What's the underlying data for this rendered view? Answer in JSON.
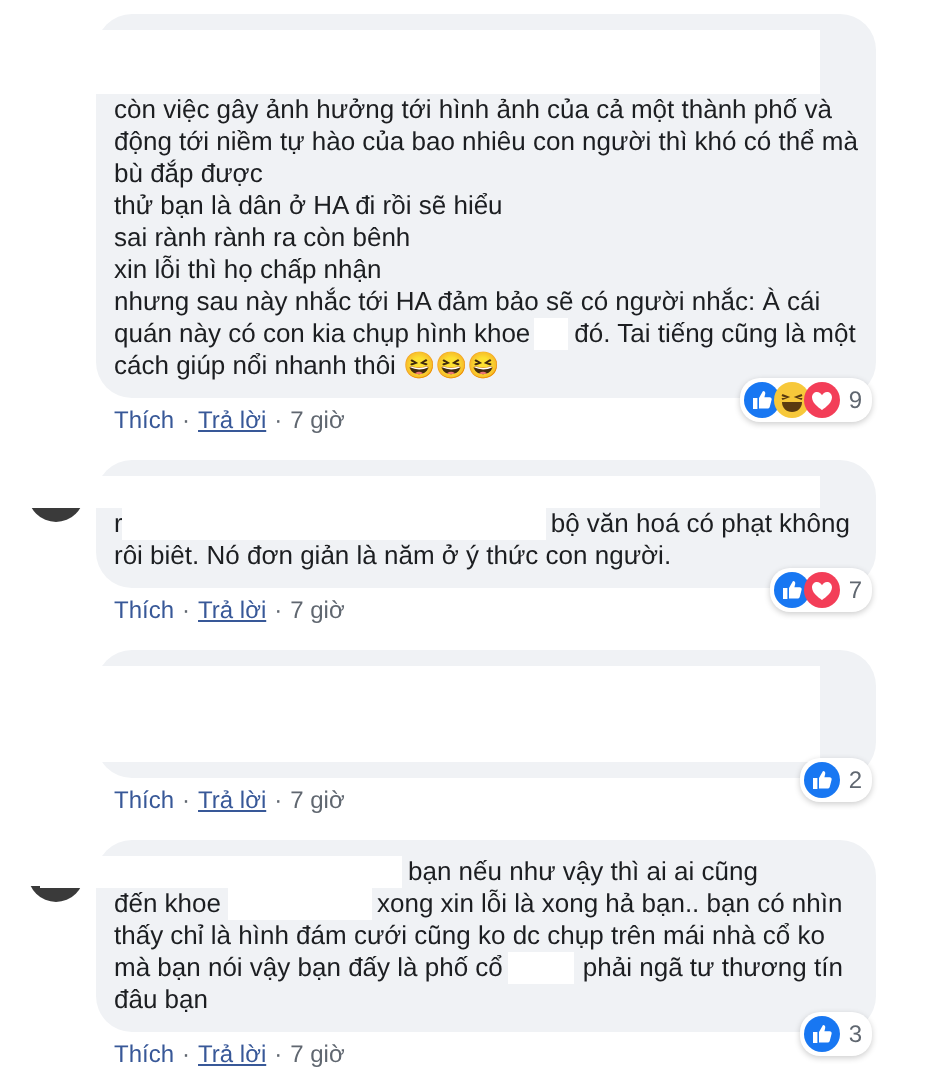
{
  "comments": [
    {
      "avatar": false,
      "lines": [
        {
          "parts": [
            {
              "kind": "full"
            }
          ]
        },
        {
          "parts": [
            {
              "kind": "full"
            }
          ]
        },
        {
          "parts": [
            {
              "kind": "text",
              "text": "còn việc gây ảnh hưởng tới hình ảnh của cả một thành phố và"
            }
          ]
        },
        {
          "parts": [
            {
              "kind": "text",
              "text": "động tới niềm tự hào của bao nhiêu con người thì khó có thể mà"
            }
          ]
        },
        {
          "parts": [
            {
              "kind": "text",
              "text": "bù đắp được"
            }
          ]
        },
        {
          "parts": [
            {
              "kind": "text",
              "text": "thử bạn là dân ở HA đi rồi sẽ hiểu"
            }
          ]
        },
        {
          "parts": [
            {
              "kind": "text",
              "text": "sai rành rành ra còn bênh"
            }
          ]
        },
        {
          "parts": [
            {
              "kind": "text",
              "text": "xin lỗi thì họ chấp nhận"
            }
          ]
        },
        {
          "parts": [
            {
              "kind": "text",
              "text": "nhưng sau này nhắc tới HA đảm bảo sẽ có người nhắc: À cái"
            }
          ]
        },
        {
          "parts": [
            {
              "kind": "text",
              "text": "quán này có con kia chụp hình khoe"
            },
            {
              "kind": "short"
            },
            {
              "kind": "text",
              "text": "đó. Tai tiếng cũng là một"
            }
          ]
        },
        {
          "parts": [
            {
              "kind": "text",
              "text": "cách giúp nổi nhanh thôi 😆😆😆"
            }
          ]
        }
      ],
      "actions": [
        {
          "kind": "link",
          "text": "Thích",
          "underlined": false
        },
        {
          "kind": "sep",
          "text": "·"
        },
        {
          "kind": "link",
          "text": "Trả lời",
          "underlined": true
        },
        {
          "kind": "sep",
          "text": "·"
        },
        {
          "kind": "time",
          "text": "7 giờ"
        }
      ],
      "reactions": {
        "icons": [
          {
            "kind": "like"
          },
          {
            "kind": "haha"
          },
          {
            "kind": "love"
          }
        ],
        "count": "9"
      }
    },
    {
      "avatar": true,
      "lines": [
        {
          "parts": [
            {
              "kind": "full"
            }
          ]
        },
        {
          "parts": [
            {
              "kind": "text",
              "text": "r"
            },
            {
              "kind": "long"
            },
            {
              "kind": "text",
              "text": "bộ văn hoá có phạt không"
            }
          ]
        },
        {
          "parts": [
            {
              "kind": "text",
              "text": "rôi biêt. Nó đơn giản là năm ở ý thức con người."
            }
          ]
        }
      ],
      "actions": [
        {
          "kind": "link",
          "text": "Thích",
          "underlined": false
        },
        {
          "kind": "sep",
          "text": "·"
        },
        {
          "kind": "link",
          "text": "Trả lời",
          "underlined": true
        },
        {
          "kind": "sep",
          "text": "·"
        },
        {
          "kind": "time",
          "text": "7 giờ"
        }
      ],
      "reactions": {
        "icons": [
          {
            "kind": "like"
          },
          {
            "kind": "love"
          }
        ],
        "count": "7"
      }
    },
    {
      "avatar": false,
      "lines": [
        {
          "parts": [
            {
              "kind": "full"
            }
          ]
        },
        {
          "parts": [
            {
              "kind": "full"
            }
          ]
        },
        {
          "parts": [
            {
              "kind": "full"
            }
          ]
        }
      ],
      "actions": [
        {
          "kind": "link",
          "text": "Thích",
          "underlined": false
        },
        {
          "kind": "sep",
          "text": "·"
        },
        {
          "kind": "link",
          "text": "Trả lời",
          "underlined": true
        },
        {
          "kind": "sep",
          "text": "·"
        },
        {
          "kind": "time",
          "text": "7 giờ"
        }
      ],
      "reactions": {
        "icons": [
          {
            "kind": "like"
          }
        ],
        "count": "2"
      }
    },
    {
      "avatar": true,
      "lines": [
        {
          "parts": [
            {
              "kind": "lead"
            },
            {
              "kind": "text",
              "text": "bạn nếu như vậy thì ai ai cũng"
            }
          ]
        },
        {
          "parts": [
            {
              "kind": "text",
              "text": "đến khoe"
            },
            {
              "kind": "wide"
            },
            {
              "kind": "text",
              "text": "xong xin lỗi là xong hả bạn.. bạn có nhìn"
            }
          ]
        },
        {
          "parts": [
            {
              "kind": "text",
              "text": "thấy chỉ là hình đám cưới cũng ko dc chụp trên mái nhà cổ ko"
            }
          ]
        },
        {
          "parts": [
            {
              "kind": "text",
              "text": "mà bạn nói vậy bạn đấy là phố cổ"
            },
            {
              "kind": "medium"
            },
            {
              "kind": "text",
              "text": "phải ngã tư thương tín"
            }
          ]
        },
        {
          "parts": [
            {
              "kind": "text",
              "text": "đâu bạn"
            }
          ]
        }
      ],
      "actions": [
        {
          "kind": "link",
          "text": "Thích",
          "underlined": false
        },
        {
          "kind": "sep",
          "text": "·"
        },
        {
          "kind": "link",
          "text": "Trả lời",
          "underlined": true
        },
        {
          "kind": "sep",
          "text": "·"
        },
        {
          "kind": "time",
          "text": "7 giờ"
        }
      ],
      "reactions": {
        "icons": [
          {
            "kind": "like"
          }
        ],
        "count": "3"
      }
    }
  ]
}
